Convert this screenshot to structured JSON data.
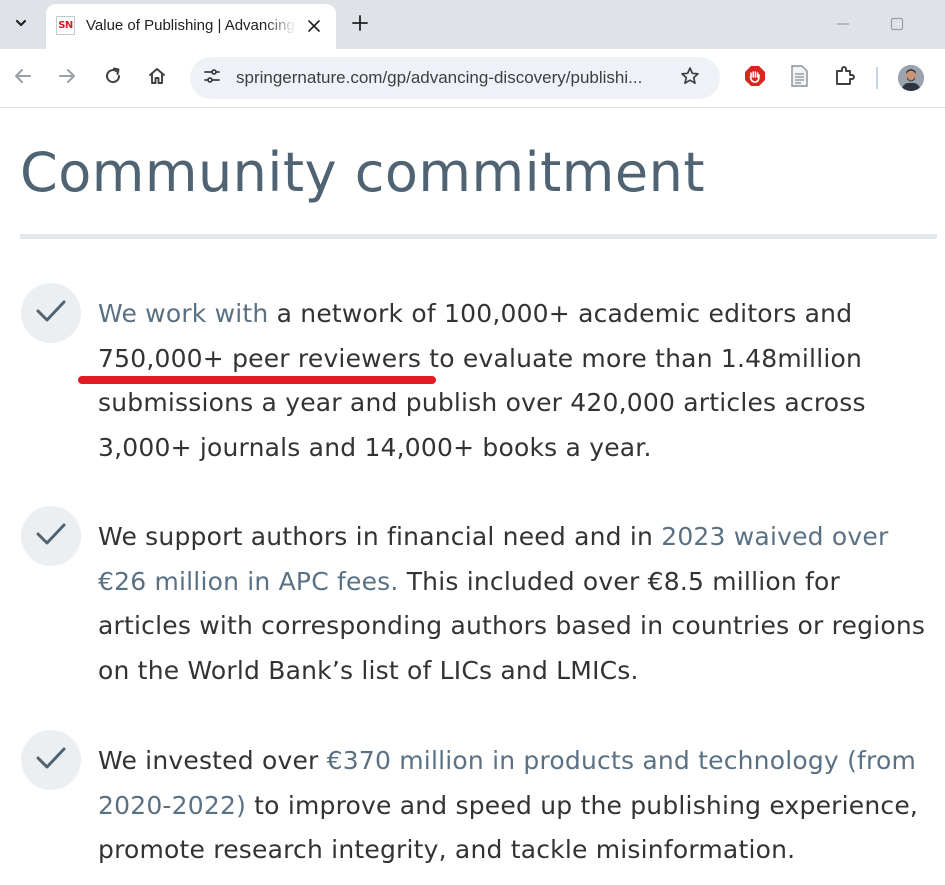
{
  "browser": {
    "tab_favicon_text": "SN",
    "tab_title": "Value of Publishing | Advancing Discovery | Springer Nature",
    "url": "springernature.com/gp/advancing-discovery/publishi...",
    "icons": [
      "chevron-down-icon",
      "close-icon",
      "plus-icon",
      "minimize-icon",
      "maximize-icon",
      "back-icon",
      "forward-icon",
      "reload-icon",
      "home-icon",
      "site-info-icon",
      "star-icon",
      "adblock-icon",
      "reader-icon",
      "extensions-icon",
      "avatar"
    ]
  },
  "page": {
    "title": "Community commitment",
    "items": [
      {
        "link": "We work with",
        "text_1": " a network of 100,000+ academic editors and 750,000+ peer reviewers to evaluate more than 1.48million submissions a year and publish over 420,000 articles across 3,000+ journals and 14,000+ books a year."
      },
      {
        "text_1": "We support authors in financial need and in ",
        "link": "2023 waived over €26 million in APC fees.",
        "text_2": " This included over €8.5 million for articles with corresponding authors based in countries or regions on the World Bank’s list of LICs and LMICs."
      },
      {
        "text_1": "We invested over ",
        "link": "€370 million in products and technology (from 2020-2022)",
        "text_2": "  to improve and speed up the publishing experience, promote research integrity, and tackle misinformation."
      }
    ]
  },
  "colors": {
    "title": "#4f6373",
    "link": "#5a7184",
    "body_text": "#333333",
    "annotation": "#e31b23",
    "check": "#4f6373"
  }
}
